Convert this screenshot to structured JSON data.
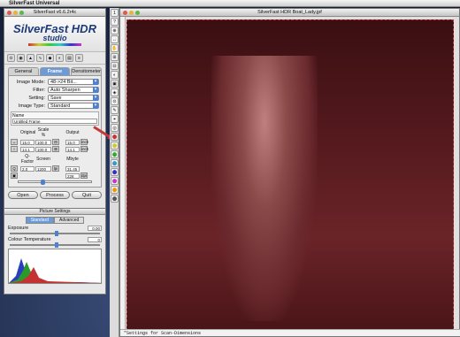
{
  "menubar": {
    "apple": "",
    "app": "SilverFast Universal"
  },
  "panel": {
    "title": "SilverFast v6.6.2r4c",
    "logo": {
      "line1": "SilverFast HDR",
      "line2": "studio"
    },
    "tabs": [
      "General",
      "Frame",
      "Densitometer"
    ],
    "fields": [
      {
        "label": "Image Mode:",
        "value": "48->24 Bit..."
      },
      {
        "label": "Filter:",
        "value": "Auto Sharpen"
      },
      {
        "label": "Setting:",
        "value": "Save"
      },
      {
        "label": "Image Type:",
        "value": "Standard"
      }
    ],
    "name_label": "Name",
    "name_value": "Untitled Frame",
    "grid_headers": [
      "Original",
      "Scale %",
      "Output"
    ],
    "row1": [
      "15.0",
      "100.0",
      "15.0",
      "inch"
    ],
    "row2": [
      "14.1",
      "100.0",
      "14.1",
      "inch"
    ],
    "grid_headers2": [
      "Q-Factor",
      "Screen",
      "Mbyte"
    ],
    "row3": [
      "2.0",
      "1200",
      "lpi",
      "31.45"
    ],
    "row4": [
      "228",
      "dpi"
    ],
    "buttons": {
      "open": "Open",
      "process": "Process",
      "quit": "Quit"
    }
  },
  "picture_settings": {
    "title": "Picture Settings",
    "tabs": [
      "Standard",
      "Advanced"
    ],
    "exposure_label": "Exposure",
    "exposure_value": "0.00",
    "colour_label": "Colour Temperature",
    "colour_value": "0"
  },
  "prescan": {
    "title": "SilverFast HDR Boat_Lady.jpf",
    "status": "\"Settings for Scan-Dimensions"
  },
  "toolcol": [
    "1",
    "?",
    "⊕",
    "↔",
    "✋",
    "⊞",
    "⊟",
    "◐",
    "▣",
    "◈",
    "⊙",
    "✎",
    "⌖",
    "◎",
    "⬤",
    "⬤",
    "⬤",
    "⬤",
    "⬤",
    "⬤",
    "⬤",
    "⬤",
    "⬤",
    "⬤",
    "⬤",
    "⬤"
  ]
}
